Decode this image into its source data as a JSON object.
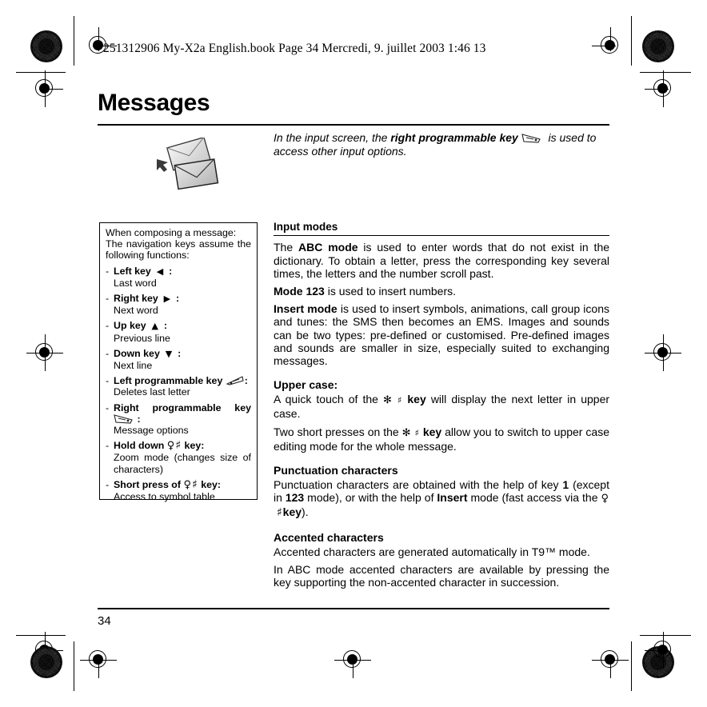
{
  "print_marks": {
    "header_line": "251312906 My-X2a English.book  Page 34  Mercredi, 9. juillet 2003  1:46 13"
  },
  "page": {
    "title": "Messages",
    "number": "34"
  },
  "intro": {
    "text_before": "In the input screen, the ",
    "bold_phrase": "right programmable key",
    "icon_name": "right-softkey-icon",
    "text_after": " is used to access other input options."
  },
  "illustration": {
    "name": "envelopes-illustration"
  },
  "sidebar": {
    "lead_line_1": "When composing a message:",
    "lead_line_2": "The navigation keys assume the following functions:",
    "items": [
      {
        "dash": "-",
        "label": "Left key",
        "glyph": "◀",
        "colon": ":",
        "description": "Last word"
      },
      {
        "dash": "-",
        "label": "Right key",
        "glyph": "▶",
        "colon": ":",
        "description": "Next word"
      },
      {
        "dash": "-",
        "label": "Up key",
        "glyph": "▲",
        "colon": ":",
        "description": "Previous line"
      },
      {
        "dash": "-",
        "label": "Down key",
        "glyph": "▼",
        "colon": ":",
        "description": "Next line"
      },
      {
        "dash": "-",
        "label": "Left programmable key",
        "icon_name": "left-softkey-icon",
        "colon": ":",
        "description": "Deletes last letter"
      },
      {
        "dash": "-",
        "label_word_1": "Right",
        "label_word_2": "programmable",
        "label_word_3": "key",
        "icon_name": "right-softkey-icon",
        "colon": ":",
        "description": "Message options"
      },
      {
        "dash": "-",
        "label_pre": "Hold down",
        "glyph_zoom": "♀",
        "glyph_hash": "♯",
        "label_post": "key:",
        "description": "Zoom mode (changes size of characters)"
      },
      {
        "dash": "-",
        "label_pre": "Short press of",
        "glyph_zoom": "♀",
        "glyph_hash": "♯",
        "label_post": "key:",
        "description": "Access to symbol table"
      }
    ]
  },
  "main": {
    "section_title": "Input modes",
    "paragraphs": [
      {
        "bold": "ABC mode",
        "prefix": "The ",
        "rest": " is used to enter words that do not exist in the dictionary. To obtain a letter, press the corresponding key several times, the letters and the number scroll past."
      },
      {
        "bold": "Mode 123",
        "prefix": "",
        "rest": " is used to insert numbers."
      },
      {
        "bold": "Insert mode",
        "prefix": "",
        "rest": " is used to insert symbols, animations, call group icons and tunes: the SMS then becomes an EMS. Images and sounds can be two types: pre-defined or customised. Pre-defined images and sounds are smaller in size, especially suited to exchanging messages."
      }
    ],
    "upper_case": {
      "heading": "Upper case:",
      "line_1_a": "A quick touch of the ",
      "line_1_key": "key",
      "line_1_b": " will display the next letter in upper case.",
      "line_2_a": "Two short presses on the ",
      "line_2_key": "key",
      "line_2_b": " allow you to switch to upper case editing mode for the whole message."
    },
    "punctuation": {
      "heading": "Punctuation characters",
      "a": "Punctuation characters are obtained with the help of key ",
      "key_1": "1",
      "b": " (except in ",
      "key_123": "123",
      "c": " mode), or with the help of ",
      "key_insert": "Insert",
      "d": " mode (fast access via the ",
      "key_label": "key",
      "e": ")."
    },
    "accented": {
      "heading": "Accented characters",
      "line_1": "Accented characters are generated automatically in T9™ mode.",
      "line_2": "In ABC mode accented characters are available by pressing the key supporting the non-accented character in succession."
    }
  }
}
